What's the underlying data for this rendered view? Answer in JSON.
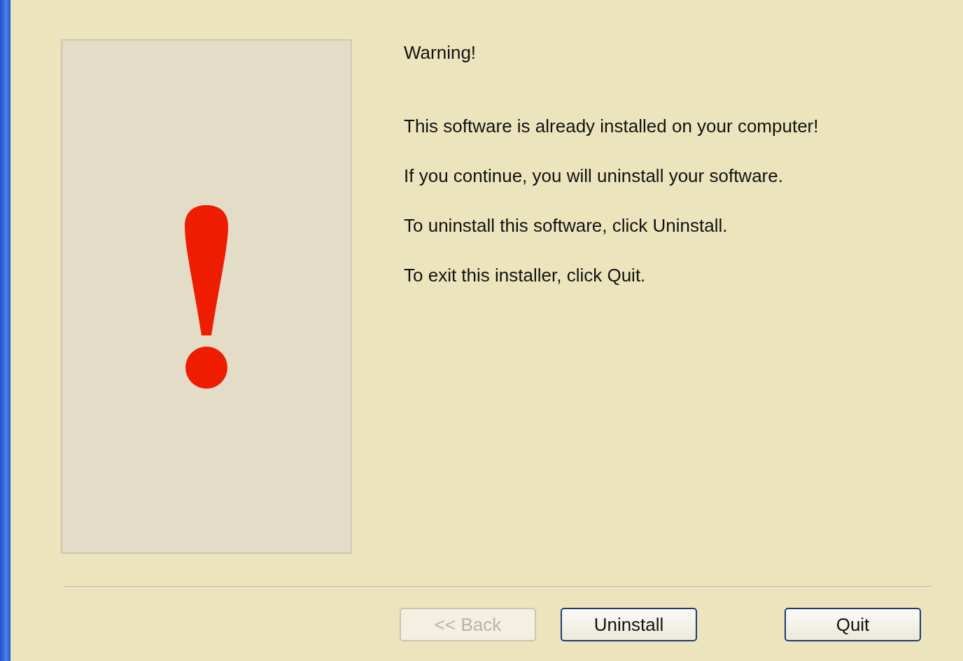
{
  "heading": "Warning!",
  "paragraphs": [
    "This software is already installed on your computer!",
    "If you continue, you will uninstall your software.",
    "To uninstall this software, click Uninstall.",
    "To exit this installer, click Quit."
  ],
  "buttons": [
    {
      "label": "<< Back",
      "disabled": true
    },
    {
      "label": "Uninstall",
      "disabled": false
    },
    {
      "label": "Quit",
      "disabled": false
    }
  ]
}
